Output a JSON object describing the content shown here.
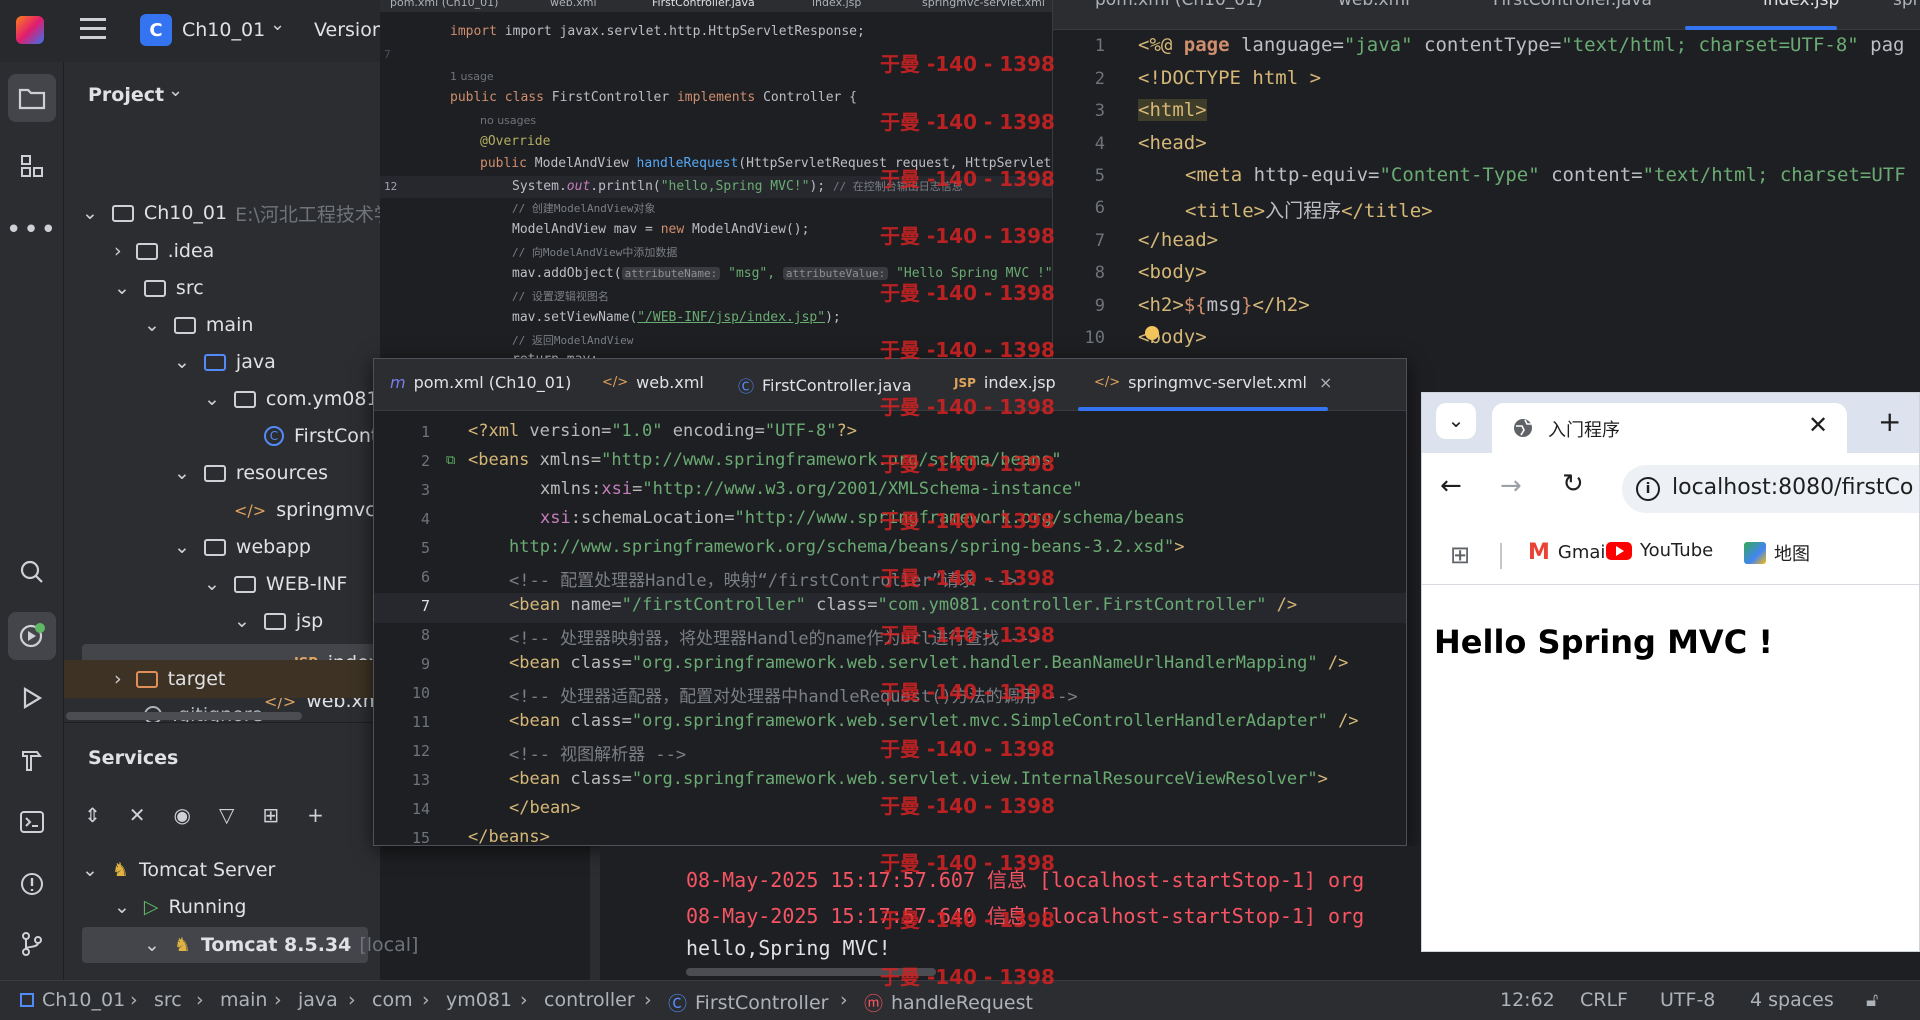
{
  "header": {
    "project_letter": "C",
    "project_name": "Ch10_01",
    "vcs_label": "Version"
  },
  "project_panel": {
    "title": "Project",
    "tree": [
      {
        "label": "Ch10_01",
        "hint": "E:\\河北工程技术学"
      },
      {
        "label": ".idea"
      },
      {
        "label": "src"
      },
      {
        "label": "main"
      },
      {
        "label": "java"
      },
      {
        "label": "com.ym081.c"
      },
      {
        "label": "FirstCont"
      },
      {
        "label": "resources"
      },
      {
        "label": "springmvc-s"
      },
      {
        "label": "webapp"
      },
      {
        "label": "WEB-INF"
      },
      {
        "label": "jsp"
      },
      {
        "label": "index"
      },
      {
        "label": "web.xml"
      },
      {
        "label": "target"
      },
      {
        "label": ".gitignore"
      }
    ]
  },
  "services": {
    "title": "Services",
    "tree": [
      {
        "label": "Tomcat Server"
      },
      {
        "label": "Running"
      },
      {
        "label": "Tomcat 8.5.34",
        "hint": "[local]"
      }
    ]
  },
  "editor_java": {
    "tabs": [
      "pom.xml (Ch10_01)",
      "web.xml",
      "FirstController.java",
      "index.jsp",
      "springmvc-servlet.xml"
    ],
    "usage_1": "1 usage",
    "usage_2": "no usages",
    "override": "@Override",
    "line_import": "import javax.servlet.http.HttpServletResponse;",
    "line_class_kw1": "public class",
    "line_class_name": " FirstController ",
    "line_class_kw2": "implements",
    "line_class_rest": " Controller {",
    "line_method_kw": "public",
    "line_method_type": " ModelAndView ",
    "line_method_name": "handleRequest",
    "line_method_rest": "(HttpServletRequest request, HttpServletR",
    "line_print_pre": "System.",
    "line_print_out": "out",
    "line_print_mid": ".println(",
    "line_print_str": "\"hello,Spring MVC!\"",
    "line_print_end": "); ",
    "line_print_cmt": "// 在控制台输出日志信息",
    "cmt_create": "// 创建ModelAndView对象",
    "line_mav_pre": "ModelAndView mav = ",
    "line_mav_kw": "new",
    "line_mav_rest": " ModelAndView();",
    "cmt_add": "// 向ModelAndView中添加数据",
    "line_add_pre": "mav.addObject(",
    "hint_attr_name": "attributeName:",
    "str_msg": " \"msg\",",
    "hint_attr_value": "attributeValue:",
    "str_hello": " \"Hello Spring MVC !\"",
    "line_add_end": ");",
    "cmt_view": "// 设置逻辑视图名",
    "line_view_pre": "mav.setViewName(",
    "str_view": "\"/WEB-INF/jsp/index.jsp\"",
    "line_view_end": ");",
    "cmt_return": "// 返回ModelAndView",
    "line_return": "return mav;"
  },
  "editor_jsp": {
    "tabs": [
      "pom.xml (Ch10_01)",
      "web.xml",
      "FirstController.java",
      "index.jsp",
      "spr"
    ],
    "lines": [
      {
        "n": "1"
      },
      {
        "n": "2"
      },
      {
        "n": "3"
      },
      {
        "n": "4"
      },
      {
        "n": "5"
      },
      {
        "n": "6"
      },
      {
        "n": "7"
      },
      {
        "n": "8"
      },
      {
        "n": "9"
      },
      {
        "n": "10"
      }
    ],
    "l1_a": "<%@ ",
    "l1_kw": "page",
    "l1_b": " language=",
    "l1_s1": "\"java\"",
    "l1_c": " contentType=",
    "l1_s2": "\"text/html; charset=UTF-8\"",
    "l1_d": " pag",
    "l2": "<!DOCTYPE html >",
    "l3": "<html>",
    "l4": "<head>",
    "l5_a": "<meta ",
    "l5_b": "http-equiv=",
    "l5_s1": "\"Content-Type\"",
    "l5_c": " content=",
    "l5_s2": "\"text/html; charset=UTF",
    "l6_a": "<title>",
    "l6_b": "入门程序",
    "l6_c": "</title>",
    "l7": "</head>",
    "l8": "<body>",
    "l9_a": "<h2>",
    "l9_b": "${",
    "l9_c": "msg",
    "l9_d": "}",
    "l9_e": "</h2>",
    "l10": "<body>"
  },
  "editor_xml": {
    "tabs": [
      "pom.xml (Ch10_01)",
      "web.xml",
      "FirstController.java",
      "index.jsp",
      "springmvc-servlet.xml"
    ],
    "lines": [
      {
        "n": "1"
      },
      {
        "n": "2"
      },
      {
        "n": "3"
      },
      {
        "n": "4"
      },
      {
        "n": "5"
      },
      {
        "n": "6"
      },
      {
        "n": "7"
      },
      {
        "n": "8"
      },
      {
        "n": "9"
      },
      {
        "n": "10"
      },
      {
        "n": "11"
      },
      {
        "n": "12"
      },
      {
        "n": "13"
      },
      {
        "n": "14"
      },
      {
        "n": "15"
      }
    ],
    "l1_a": "<?xml ",
    "l1_b": "version=",
    "l1_s1": "\"1.0\"",
    "l1_c": " encoding=",
    "l1_s2": "\"UTF-8\"",
    "l1_d": "?>",
    "l2_a": "<beans ",
    "l2_b": "xmlns=",
    "l2_s": "\"http://www.springframework.org/schema/beans\"",
    "l3_a": "xmlns:",
    "l3_b": "xsi",
    "l3_c": "=",
    "l3_s": "\"http://www.w3.org/2001/XMLSchema-instance\"",
    "l4_a": "xsi",
    "l4_b": ":schemaLocation=",
    "l4_s": "\"http://www.springframework.org/schema/beans",
    "l5_s": "http://www.springframework.org/schema/beans/spring-beans-3.2.xsd\"",
    "l5_e": ">",
    "l6": "<!-- 配置处理器Handle，映射“/firstController”请求 -->",
    "l7_a": "<bean ",
    "l7_b": "name=",
    "l7_s1": "\"/firstController\"",
    "l7_c": " class=",
    "l7_s2": "\"com.ym081.controller.FirstController\"",
    "l7_d": " />",
    "l8": "<!-- 处理器映射器，将处理器Handle的name作为url进行查找 -->",
    "l9_a": "<bean ",
    "l9_b": "class=",
    "l9_s": "\"org.springframework.web.servlet.handler.BeanNameUrlHandlerMapping\"",
    "l9_d": " />",
    "l10": "<!-- 处理器适配器，配置对处理器中handleRequest()方法的调用 -->",
    "l11_a": "<bean ",
    "l11_b": "class=",
    "l11_s": "\"org.springframework.web.servlet.mvc.SimpleControllerHandlerAdapter\"",
    "l11_d": " />",
    "l12": "<!-- 视图解析器 -->",
    "l13_a": "<bean ",
    "l13_b": "class=",
    "l13_s": "\"org.springframework.web.servlet.view.InternalResourceViewResolver\"",
    "l13_d": ">",
    "l14": "</bean>",
    "l15": "</beans>"
  },
  "console": {
    "line1_time": "08-May-2025 15:17:57.607 ",
    "line1_level": "信息",
    "line1_rest": " [localhost-startStop-1] org",
    "line2_time": "08-May-2025 15:17:57.640 ",
    "line2_level": "信息",
    "line2_rest": " [localhost-startStop-1] org",
    "line3": "hello,Spring MVC!"
  },
  "browser": {
    "tab_title": "入门程序",
    "url": "localhost:8080/firstCo",
    "bookmarks": [
      "Gmail",
      "YouTube",
      "地图"
    ],
    "page_heading": "Hello Spring MVC !"
  },
  "statusbar": {
    "breadcrumbs": [
      "Ch10_01",
      "src",
      "main",
      "java",
      "com",
      "ym081",
      "controller",
      "FirstController",
      "handleRequest"
    ],
    "position": "12:62",
    "line_sep": "CRLF",
    "encoding": "UTF-8",
    "indent": "4 spaces"
  },
  "watermark": "于曼 -140 - 1398",
  "colors": {
    "accent": "#3574f0",
    "string": "#6aab73",
    "keyword": "#cf8e6d",
    "tag": "#d5b778",
    "watermark": "#d62222",
    "console_red": "#f75464"
  }
}
